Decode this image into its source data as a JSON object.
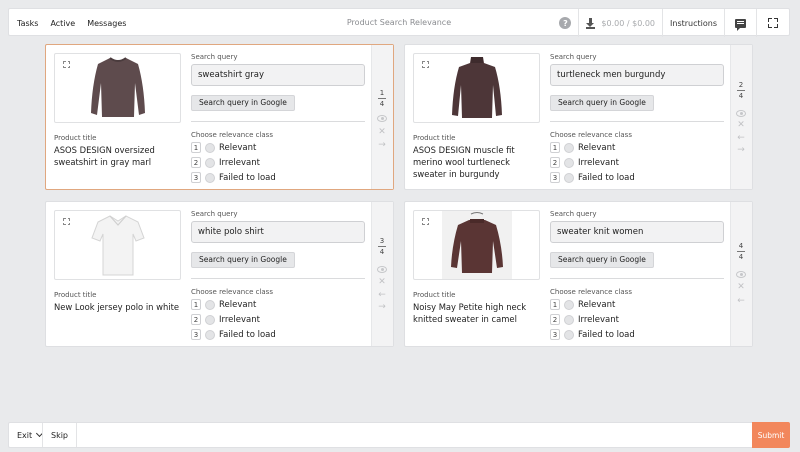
{
  "topbar": {
    "nav": [
      "Tasks",
      "Active",
      "Messages"
    ],
    "title": "Product Search Relevance",
    "balance": "$0.00 / $0.00",
    "instructions": "Instructions"
  },
  "labels": {
    "search_query": "Search query",
    "google_button": "Search query in Google",
    "product_title": "Product title",
    "relevance_class": "Choose relevance class",
    "options": [
      "Relevant",
      "Irrelevant",
      "Failed to load"
    ],
    "option_keys": [
      "1",
      "2",
      "3"
    ]
  },
  "cards": [
    {
      "query": "sweatshirt gray",
      "title": "ASOS DESIGN oversized sweatshirt in gray marl",
      "counter": "1",
      "total": "4",
      "active": true,
      "image": "sweatshirt-image"
    },
    {
      "query": "turtleneck men burgundy",
      "title": "ASOS DESIGN muscle fit merino wool turtleneck sweater in burgundy",
      "counter": "2",
      "total": "4",
      "active": false,
      "image": "turtleneck-image"
    },
    {
      "query": "white polo shirt",
      "title": "New Look jersey polo in white",
      "counter": "3",
      "total": "4",
      "active": false,
      "image": "polo-image"
    },
    {
      "query": "sweater knit women",
      "title": "Noisy May Petite high neck knitted sweater in camel",
      "counter": "4",
      "total": "4",
      "active": false,
      "image": "knit-sweater-image"
    }
  ],
  "bottombar": {
    "exit": "Exit",
    "skip": "Skip",
    "submit": "Submit"
  },
  "colors": {
    "accent": "#f2875c",
    "active_border": "#e0a77f",
    "background": "#e9eaec"
  }
}
